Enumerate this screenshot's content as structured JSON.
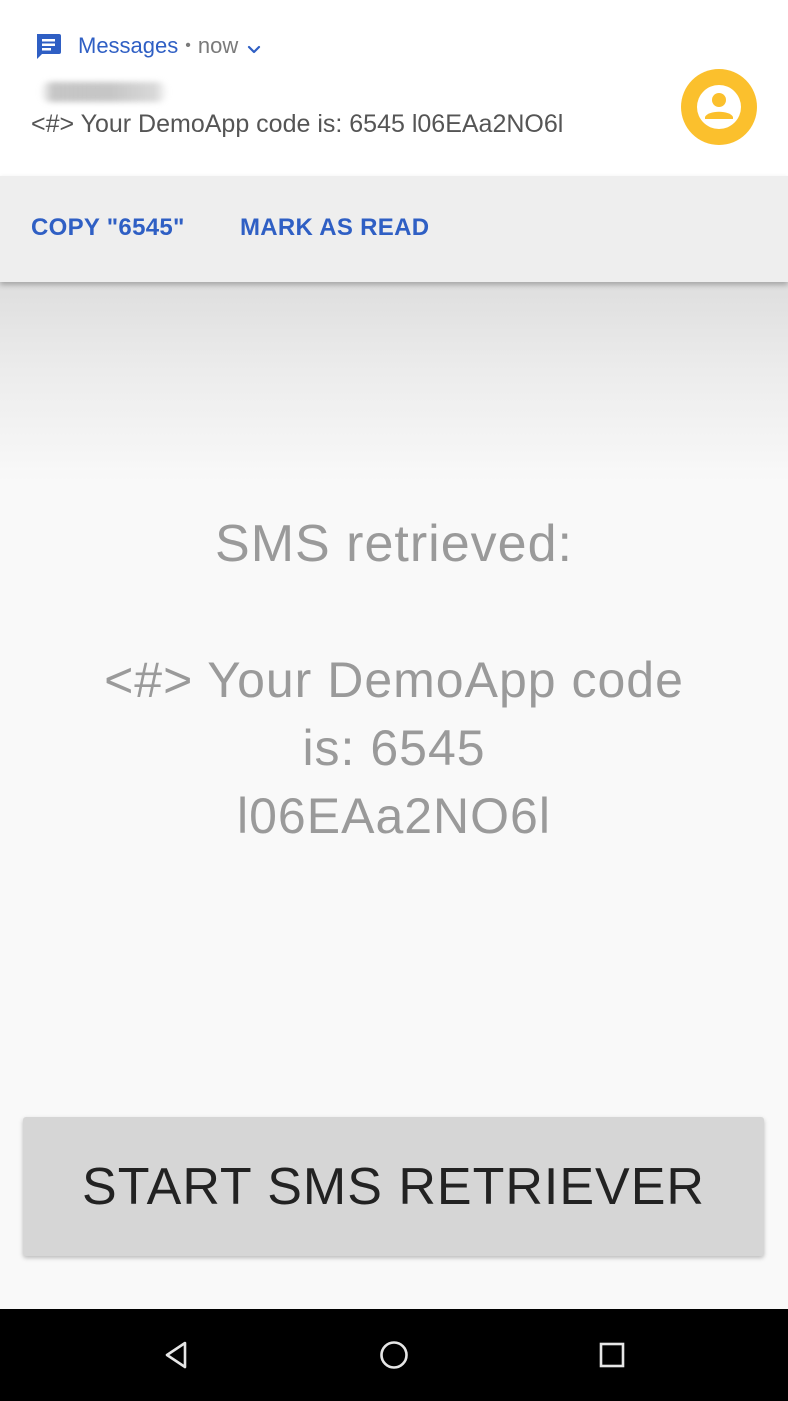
{
  "notification": {
    "app_icon": "messages-icon",
    "app_name": "Messages",
    "separator": "•",
    "time": "now",
    "expand_icon": "chevron-down-icon",
    "text": "<#> Your DemoApp code is: 6545 l06EAa2NO6l",
    "avatar_icon": "person-icon",
    "avatar_color": "#fbc02d",
    "actions": [
      {
        "label": "COPY \"6545\""
      },
      {
        "label": "MARK AS READ"
      }
    ],
    "accent_color": "#2f5fc4"
  },
  "app": {
    "title": "SMS retrieved:",
    "message_lines": [
      "<#> Your DemoApp code",
      "is: 6545",
      "l06EAa2NO6l"
    ],
    "start_button_label": "START SMS RETRIEVER"
  },
  "navbar": {
    "back_icon": "back-triangle-icon",
    "home_icon": "home-circle-icon",
    "recent_icon": "recent-apps-square-icon"
  }
}
